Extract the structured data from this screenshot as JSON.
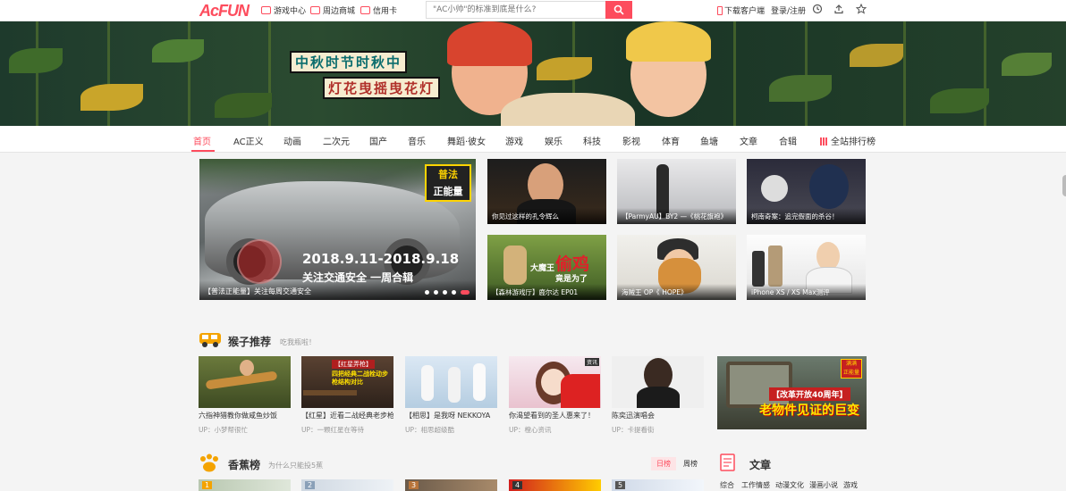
{
  "header": {
    "logo": "AcFUN",
    "links": [
      "游戏中心",
      "周边商城",
      "信用卡"
    ],
    "search_placeholder": "\"AC小帅\"的标准到底是什么?",
    "download": "下载客户端",
    "login": "登录/注册",
    "colors": {
      "accent": "#fd4c5d"
    }
  },
  "banner": {
    "line1": "中秋时节时秋中",
    "line2": "灯花曳摇曳花灯"
  },
  "nav": {
    "items": [
      "首页",
      "AC正义",
      "动画",
      "二次元",
      "国产",
      "音乐",
      "舞蹈·彼女",
      "游戏",
      "娱乐",
      "科技",
      "影视",
      "体育",
      "鱼塘",
      "文章",
      "合辑",
      "全站排行榜"
    ],
    "active_index": 0
  },
  "slider": {
    "badge": [
      "普法",
      "正能量"
    ],
    "overlay_line1": "2018.9.11-2018.9.18",
    "overlay_line2": "关注交通安全 一周合辑",
    "title": "【普法正能量】关注每周交通安全",
    "dots": 5,
    "active_dot": 4
  },
  "thumbs": [
    {
      "title": "你见过这样的孔令辉么"
    },
    {
      "title": "【ParmyAU】BY2 —《桃花旗袍》"
    },
    {
      "title": "柯南奇案：追完假面的杀谷！"
    },
    {
      "title": "【森林游戏厅】鹿尔达 EP01",
      "overlay_a": "大魔王",
      "overlay_b": "偷鸡",
      "overlay_c": "竟是为了"
    },
    {
      "title": "海贼王 OP《 HOPE》"
    },
    {
      "title": "iPhone XS / XS Max测评"
    }
  ],
  "monkey": {
    "title": "猴子推荐",
    "subtitle": "吃我瓶啦！",
    "cards": [
      {
        "title": "六指神猎教你做咸鱼炒饭",
        "up": "UP：小梦帮很忙"
      },
      {
        "title": "【红星】近看二战经典老步枪",
        "up": "UP：一颗红星在等待",
        "badge": "【红星弄枪】",
        "overlay": "四把经典二战栓动步枪结构对比"
      },
      {
        "title": "【相思】是我呀 NEKKOYA",
        "up": "UP：相思超级酷"
      },
      {
        "title": "你渴望看到的圣人惠来了！",
        "up": "UP：橙心资讯",
        "tag": "资讯"
      },
      {
        "title": "陈奕迅演唱会",
        "up": "UP：卡提看街"
      }
    ],
    "ad": {
      "badge_line1": "满满",
      "badge_line2": "正能量",
      "line1": "【改革开放40周年】",
      "line2": "老物件见证的巨变"
    }
  },
  "banana": {
    "title": "香蕉榜",
    "subtitle": "为什么只能投5蕉",
    "tabs": [
      "日榜",
      "周榜"
    ],
    "ranks": [
      "1",
      "2",
      "3",
      "4",
      "5"
    ]
  },
  "articles": {
    "title": "文章",
    "tags": [
      "综合",
      "工作情感",
      "动漫文化",
      "漫画小说",
      "游戏"
    ]
  }
}
